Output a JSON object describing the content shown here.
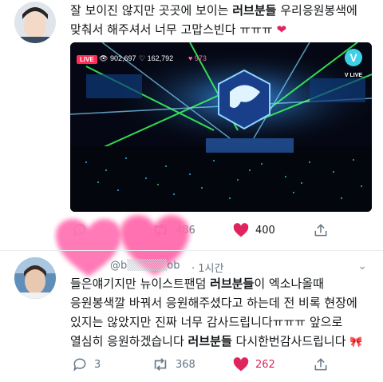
{
  "tweet1": {
    "line1_pre": "잘 보이진 않지만 곳곳에 보이는 ",
    "line1_bold": "러브분들",
    "line1_post": " 우리응원봉색에",
    "line2": "맞춰서 해주셔서 너무 고맙스빈다 ㅠㅠㅠ ",
    "heart": "❤",
    "media": {
      "live_label": "LIVE",
      "viewers": "902,697",
      "likes": "162,792",
      "hearts": "973",
      "vlive_logo_letter": "V",
      "vlive_logo_text": "V LIVE"
    },
    "actions": {
      "reply_count": "",
      "retweet_count": "486",
      "like_count": "400"
    }
  },
  "tweet2": {
    "handle": "@b",
    "handle_tail": "ob",
    "time": "· 1시간",
    "line1_pre": "들은얘기지만 뉴이스트팬덤 ",
    "line1_bold": "러브분들",
    "line1_post": "이 엑소나올때",
    "line2": "응원봉색깔 바꿔서 응원해주셨다고 하는데 전 비록 현장에",
    "line3": "있지는 않았지만 진짜 너무 감사드립니다ㅠㅠㅠ 앞으로",
    "line4_pre": "열심히 응원하겠습니다 ",
    "line4_bold": "러브분들",
    "line4_post": " 다시한번감사드립니다",
    "ribbon": "🎀",
    "actions": {
      "reply_count": "3",
      "retweet_count": "368",
      "like_count": "262"
    }
  },
  "colors": {
    "heart_red": "#e0245e",
    "grey_icon": "#657786",
    "divider": "#e6ecf0"
  }
}
